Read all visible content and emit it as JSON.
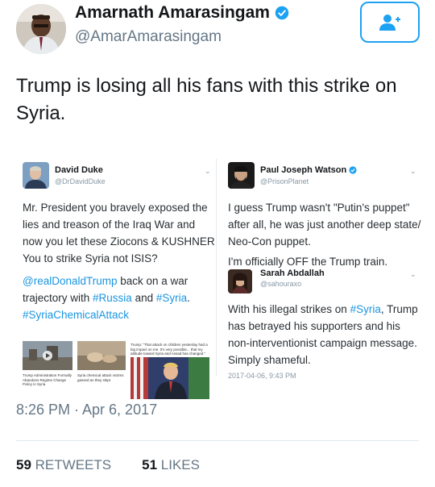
{
  "tweet": {
    "author_name": "Amarnath Amarasingam",
    "author_handle": "@AmarAmarasingam",
    "text": "Trump is losing all his fans with this strike on Syria.",
    "timestamp": "8:26 PM · Apr 6, 2017",
    "retweets_count": "59",
    "retweets_label": "RETWEETS",
    "likes_count": "51",
    "likes_label": "LIKES",
    "follow_icon": "add-user-icon",
    "accent_color": "#1da1f2"
  },
  "embedded": {
    "left": {
      "name": "David Duke",
      "handle": "@DrDavidDuke",
      "text_lines": [
        "Mr. President you bravely exposed the",
        "lies and treason of the Iraq War and",
        "now you let these Ziocons & KUSHNER",
        "You to strike Syria not ISIS?"
      ],
      "mention": "@realDonaldTrump",
      "line5_mid": " back on a war",
      "line6_a": "trajectory with ",
      "hashtag_russia": "#Russia",
      "line6_and": " and ",
      "hashtag_syria": "#Syria",
      "line6_end": ".",
      "hashtag_chem": "#SyriaChemicalAttack",
      "thumb_captions": [
        "Trump Administration Formally Abandons Regime Change Policy in Syria",
        "Syria chemical attack victims gassed as they slept",
        "Trump: \"That attack on children yesterday had a big impact on me. It's very possible... that my attitude toward Syria and Assad has changed.\""
      ]
    },
    "right_top": {
      "name": "Paul Joseph Watson",
      "handle": "@PrisonPlanet",
      "text_lines": [
        "I guess Trump wasn't \"Putin's puppet\"",
        "after all, he was just another deep state/",
        "Neo-Con puppet."
      ],
      "text_line_2": "I'm officially OFF the Trump train."
    },
    "right_bottom": {
      "name": "Sarah Abdallah",
      "handle": "@sahouraxo",
      "line1_a": "With his illegal strikes on ",
      "hashtag": "#Syria",
      "line1_b": ", Trump",
      "text_lines": [
        "has betrayed his supporters and his",
        "non-interventionist campaign message.",
        "Simply shameful."
      ],
      "timestamp": "2017-04-06, 9:43 PM"
    }
  }
}
